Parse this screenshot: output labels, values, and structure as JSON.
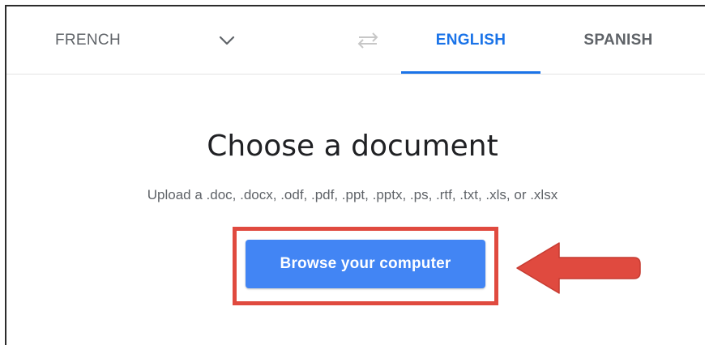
{
  "languages": {
    "source": "FRENCH",
    "target_active": "ENGLISH",
    "target_other": "SPANISH"
  },
  "main": {
    "title": "Choose a document",
    "subtitle": "Upload a .doc, .docx, .odf, .pdf, .ppt, .pptx, .ps, .rtf, .txt, .xls, or .xlsx",
    "browse_label": "Browse your computer"
  },
  "icons": {
    "dropdown": "chevron-down-icon",
    "swap": "swap-languages-icon",
    "pointer": "red-arrow-annotation"
  },
  "colors": {
    "accent": "#1a73e8",
    "button": "#4285f4",
    "annotation": "#e04a3f"
  }
}
